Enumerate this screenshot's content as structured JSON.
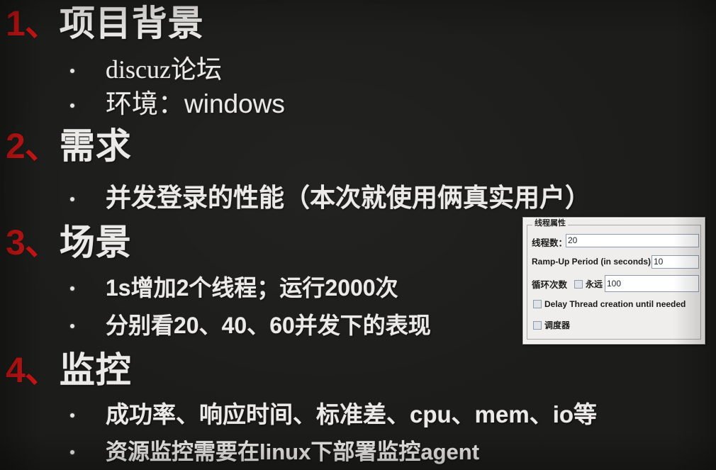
{
  "slide": {
    "background_color": "#1c1c1a",
    "accent_color": "#cc1515",
    "text_color": "#eceae6",
    "sections": [
      {
        "number": "1、",
        "title": "项目背景",
        "bullets": [
          "discuz论坛",
          "环境：windows"
        ]
      },
      {
        "number": "2、",
        "title": "需求",
        "bullets": [
          "并发登录的性能（本次就使用俩真实用户）"
        ]
      },
      {
        "number": "3、",
        "title": "场景",
        "bullets": [
          "1s增加2个线程；运行2000次",
          "分别看20、40、60并发下的表现"
        ]
      },
      {
        "number": "4、",
        "title": "监控",
        "bullets": [
          "成功率、响应时间、标准差、cpu、mem、io等",
          "资源监控需要在linux下部署监控agent"
        ]
      }
    ]
  },
  "thread_dialog": {
    "panel_title": "线程属性",
    "thread_count": {
      "label": "线程数：",
      "value": "20"
    },
    "ramp_up": {
      "label": "Ramp-Up Period (in seconds):",
      "value": "10"
    },
    "loop_count": {
      "label": "循环次数",
      "forever_label": "永远",
      "forever_checked": false,
      "value": "100"
    },
    "delay_thread_creation": {
      "label": "Delay Thread creation until needed",
      "checked": false
    },
    "scheduler": {
      "label": "调度器",
      "checked": false
    }
  }
}
